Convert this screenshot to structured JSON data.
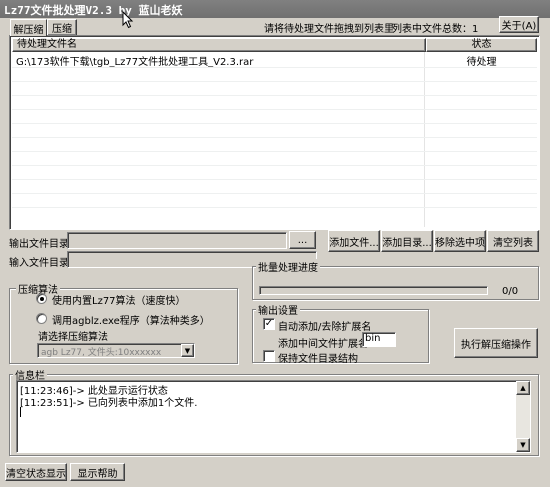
{
  "window": {
    "title": "Lz77文件批处理V2.3 by 蓝山老妖"
  },
  "tabs": [
    {
      "label": "解压缩"
    },
    {
      "label": "压缩"
    }
  ],
  "header": {
    "drop_hint": "请将待处理文件拖拽到列表里",
    "count_label": "列表中文件总数：1",
    "about_label": "关于(A)"
  },
  "file_list": {
    "columns": [
      "待处理文件名",
      "状态"
    ],
    "rows": [
      {
        "name": "G:\\173软件下载\\tgb_Lz77文件批处理工具_V2.3.rar",
        "status": "待处理"
      }
    ]
  },
  "output_dir": {
    "label": "输出文件目录",
    "value": "",
    "browse": "..."
  },
  "input_dir": {
    "label": "输入文件目录",
    "value": ""
  },
  "list_buttons": {
    "add_file": "添加文件...",
    "add_dir": "添加目录...",
    "remove": "移除选中项",
    "clear": "清空列表"
  },
  "compression": {
    "group_title": "压缩算法",
    "option_builtin": "使用内置Lz77算法（速度快）",
    "option_external": "调用agblz.exe程序（算法种类多）",
    "select_label": "请选择压缩算法",
    "select_value": "agb Lz77, 文件头:10xxxxxx",
    "selected": "builtin"
  },
  "batch": {
    "group_title": "批量处理进度",
    "progress_text": "0/0",
    "progress": 0
  },
  "output_settings": {
    "group_title": "输出设置",
    "auto_ext_label": "自动添加/去除扩展名",
    "auto_ext_checked": true,
    "ext_label": "添加中间文件扩展名",
    "ext_value": "bin",
    "keep_structure_label": "保持文件目录结构",
    "keep_structure_checked": false
  },
  "run_button": "执行解压缩操作",
  "info": {
    "group_title": "信息栏",
    "lines": [
      "[11:23:46]-> 此处显示运行状态",
      "[11:23:51]-> 已向列表中添加1个文件."
    ]
  },
  "footer": {
    "clear_status": "清空状态显示",
    "show_help": "显示帮助"
  }
}
